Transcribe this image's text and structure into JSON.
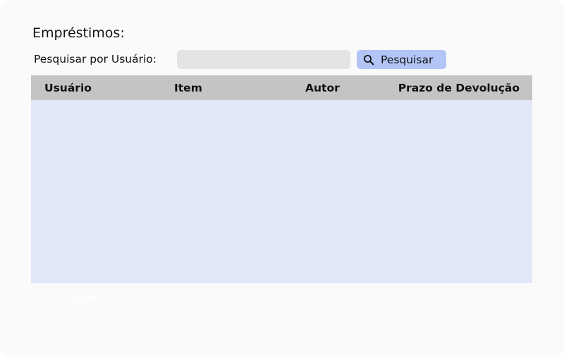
{
  "page": {
    "title": "Empréstimos:"
  },
  "search": {
    "label": "Pesquisar por Usuário:",
    "value": "",
    "placeholder": "",
    "button_label": "Pesquisar",
    "button_icon": "search-icon"
  },
  "table": {
    "columns": [
      "Usuário",
      "Item",
      "Autor",
      "Prazo de Devolução"
    ],
    "rows": []
  },
  "footer": {
    "faded_text": "Senha"
  },
  "colors": {
    "background": "#fbfafb",
    "input_background": "#e4e4e4",
    "button_background": "#b3c5f7",
    "table_header_background": "#c4c4c4",
    "table_body_background": "#e1e7f7"
  }
}
